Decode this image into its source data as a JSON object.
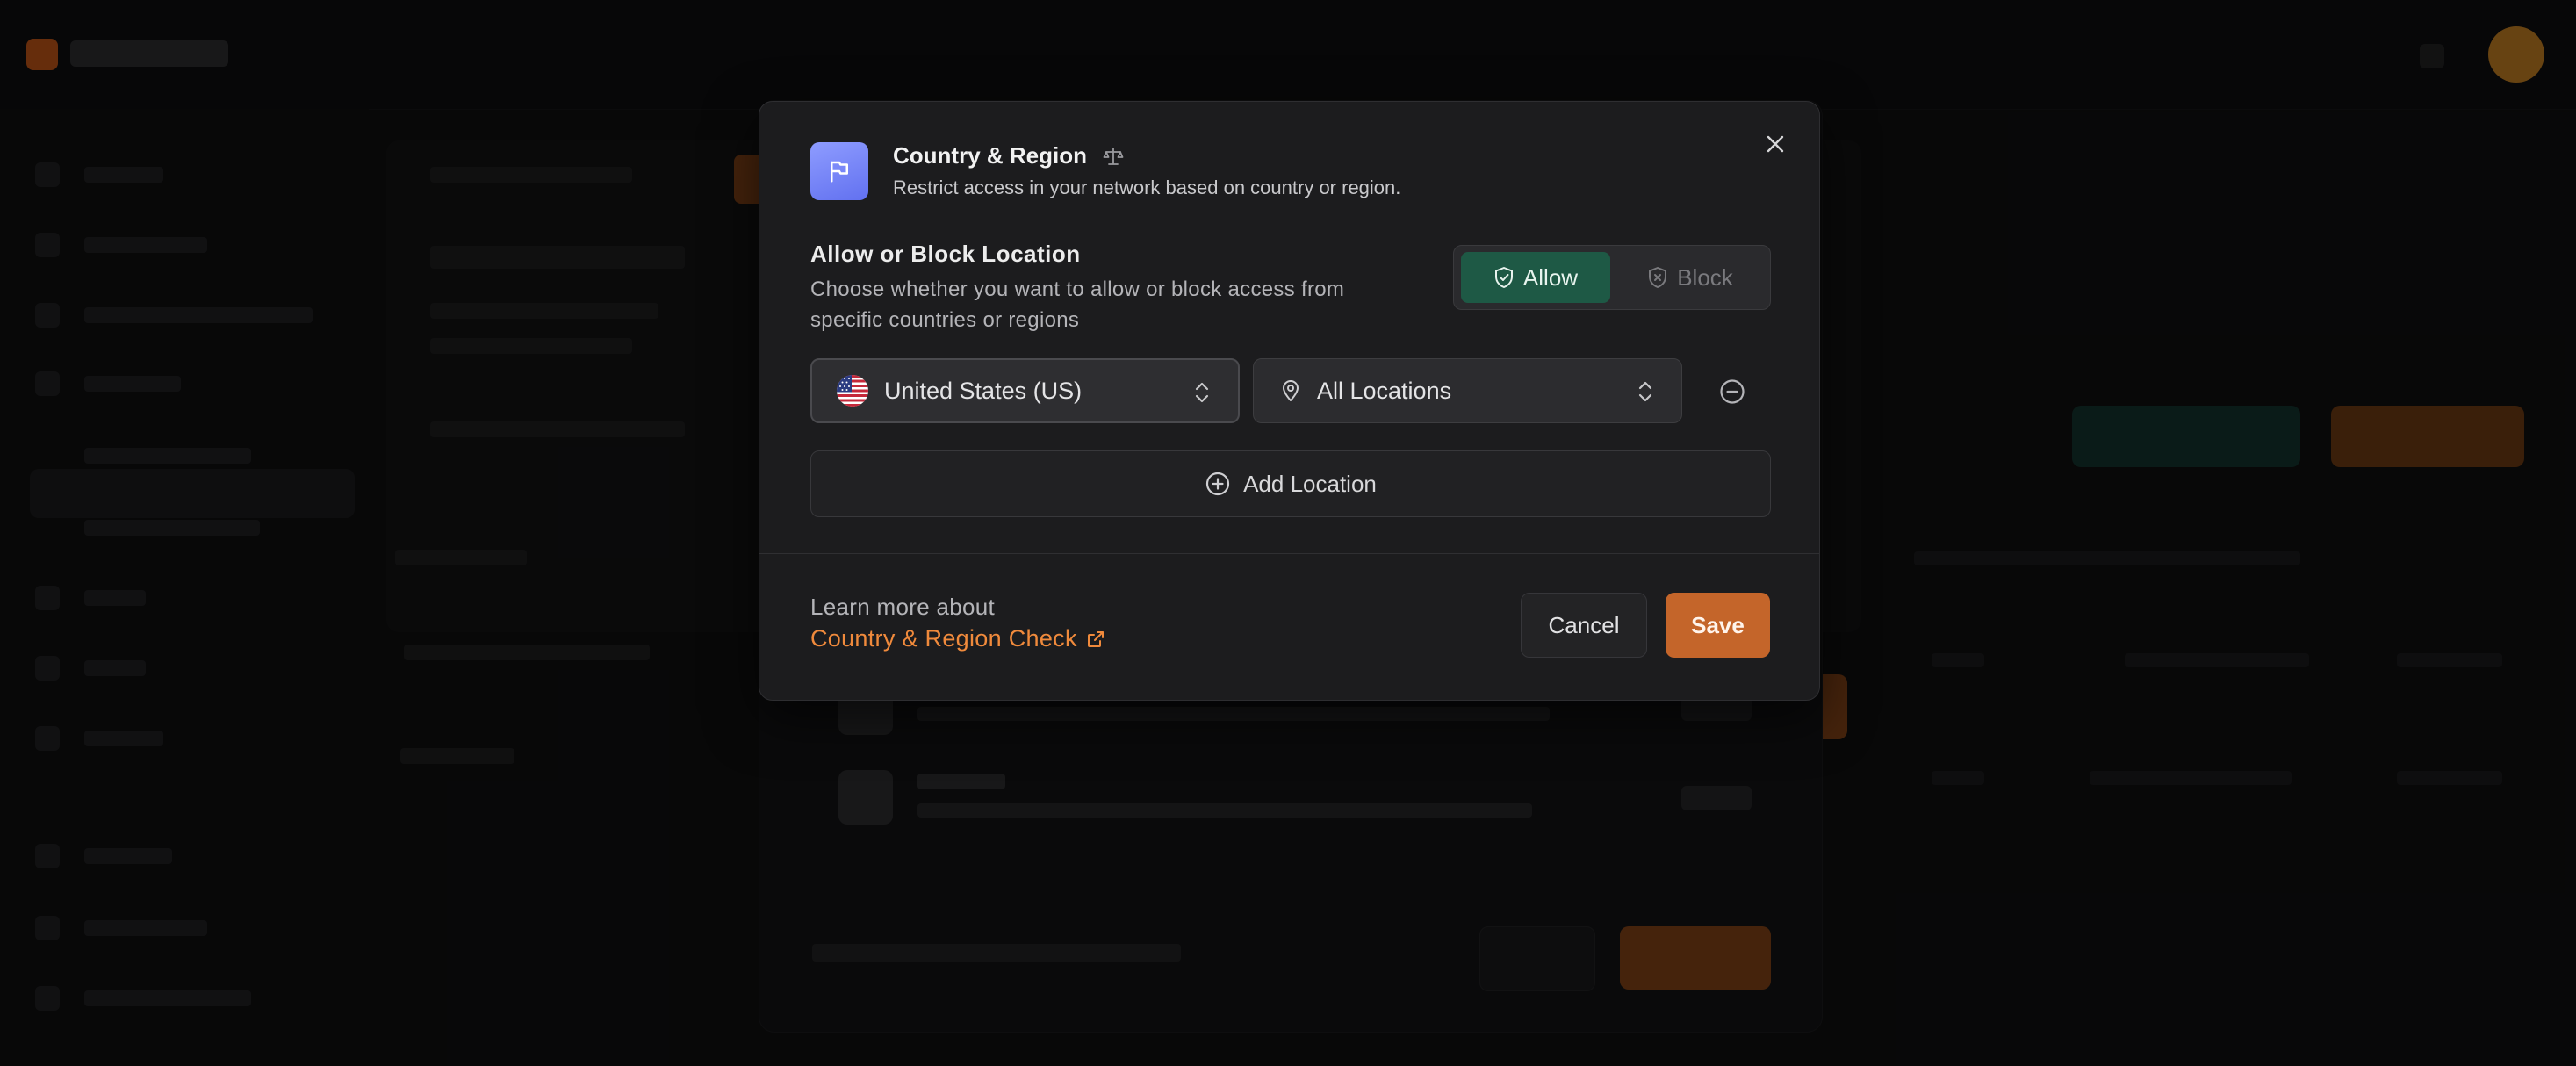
{
  "modal": {
    "title": "Country & Region",
    "subtitle": "Restrict access in your network based on country or region.",
    "section_title": "Allow or Block Location",
    "section_description": "Choose whether you want to allow or block access from specific countries or regions",
    "toggle": {
      "allow_label": "Allow",
      "block_label": "Block",
      "selected": "Allow"
    },
    "rule": {
      "country": "United States (US)",
      "location": "All Locations"
    },
    "add_location_label": "Add Location",
    "footer": {
      "learn_more_prefix": "Learn more about",
      "learn_more_link": "Country & Region Check",
      "cancel_label": "Cancel",
      "save_label": "Save"
    }
  },
  "icons": {
    "header": "flag-icon",
    "title_badge": "scale-icon",
    "close": "close-icon",
    "allow": "shield-check-icon",
    "block": "shield-x-icon",
    "country_flag": "us-flag-icon",
    "location": "map-pin-icon",
    "select_chevron": "chevron-up-down-icon",
    "remove": "minus-circle-icon",
    "add": "plus-circle-icon",
    "external_link": "external-link-icon"
  },
  "colors": {
    "accent": "#c4652a",
    "link": "#f08a3c",
    "allow_active": "#1e5945",
    "header_icon": "#7482f7"
  }
}
